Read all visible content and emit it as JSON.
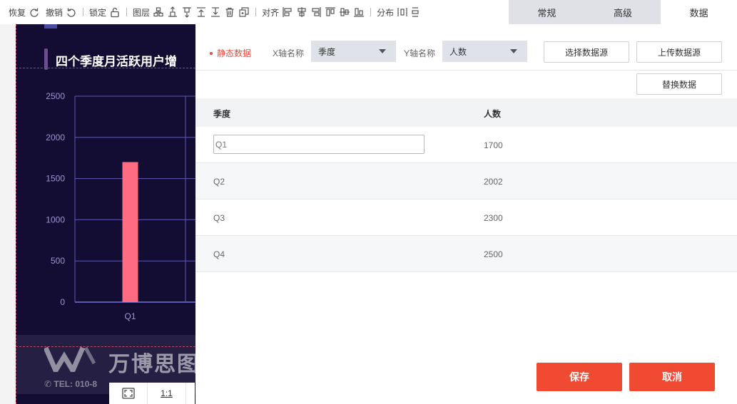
{
  "toolbar": {
    "restore_label": "恢复",
    "undo_label": "撤销",
    "lock_label": "锁定",
    "layer_label": "图层",
    "align_label": "对齐",
    "distribute_label": "分布"
  },
  "tabs": [
    {
      "label": "常规",
      "active": false
    },
    {
      "label": "高级",
      "active": false
    },
    {
      "label": "数据",
      "active": true
    }
  ],
  "slide": {
    "title": "四个季度月活跃用户增",
    "watermark_brand": "万博思图",
    "watermark_tel": "✆ TEL: 010-8",
    "background": "#130d33"
  },
  "chart_data": {
    "type": "bar",
    "categories": [
      "Q1"
    ],
    "values": [
      1700
    ],
    "yticks": [
      0,
      500,
      1000,
      1500,
      2000,
      2500
    ],
    "ylim": [
      0,
      2500
    ],
    "bar_color": "#ff6b81",
    "axis_color": "#5e59b0",
    "tick_label_color": "#9d97d4",
    "grid": true
  },
  "zoom": {
    "fit_icon": "fit-screen-icon",
    "ratio_label": "1:1"
  },
  "panel": {
    "static_label": "静态数据",
    "x_axis_label": "X轴名称",
    "x_axis_value": "季度",
    "y_axis_label": "Y轴名称",
    "y_axis_value": "人数",
    "select_source_label": "选择数据源",
    "upload_source_label": "上传数据源",
    "replace_data_label": "替换数据",
    "columns": [
      "季度",
      "人数"
    ],
    "rows": [
      {
        "quarter": "Q1",
        "count": "1700"
      },
      {
        "quarter": "Q2",
        "count": "2002"
      },
      {
        "quarter": "Q3",
        "count": "2300"
      },
      {
        "quarter": "Q4",
        "count": "2500"
      }
    ],
    "save_label": "保存",
    "cancel_label": "取消"
  },
  "colors": {
    "accent": "#f04a33",
    "static_label": "#e84b3c",
    "tab_inactive_bg": "#dfe1e6"
  }
}
